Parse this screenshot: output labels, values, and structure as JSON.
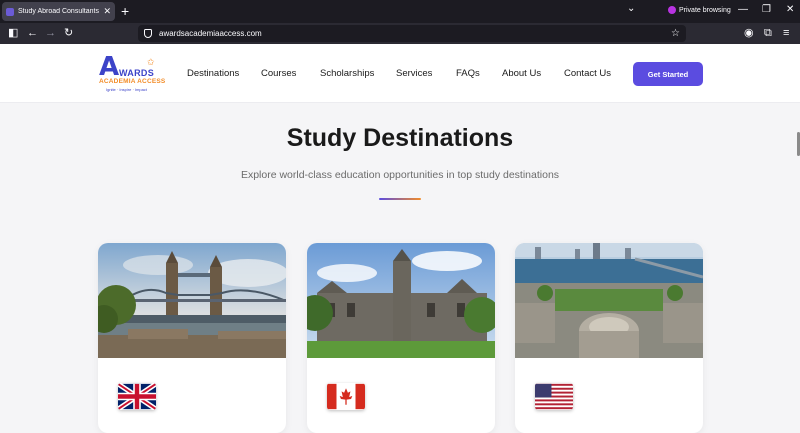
{
  "browser": {
    "tab_title": "Study Abroad Consultants Kenya",
    "new_tab_label": "+",
    "private_label": "Private browsing",
    "url": "awardsacademiaaccess.com"
  },
  "logo": {
    "letter": "A",
    "word": "WARDS",
    "subtitle": "ACADEMIA ACCESS",
    "tagline": "Ignite · Inspire · Impact"
  },
  "nav": {
    "items": [
      "Destinations",
      "Courses",
      "Scholarships",
      "Services",
      "FAQs",
      "About Us",
      "Contact Us"
    ],
    "cta": "Get Started"
  },
  "hero": {
    "title": "Study Destinations",
    "subtitle": "Explore world-class education opportunities in top study destinations"
  },
  "colors": {
    "brand_blue": "#3c43c8",
    "brand_orange": "#f28c28",
    "cta": "#5b4ce0"
  },
  "cards": [
    {
      "photo_icon": "london-tower-bridge-photo",
      "flag_icon": "uk-flag-icon"
    },
    {
      "photo_icon": "toronto-university-photo",
      "flag_icon": "canada-flag-icon"
    },
    {
      "photo_icon": "boston-mit-photo",
      "flag_icon": "usa-flag-icon"
    }
  ]
}
